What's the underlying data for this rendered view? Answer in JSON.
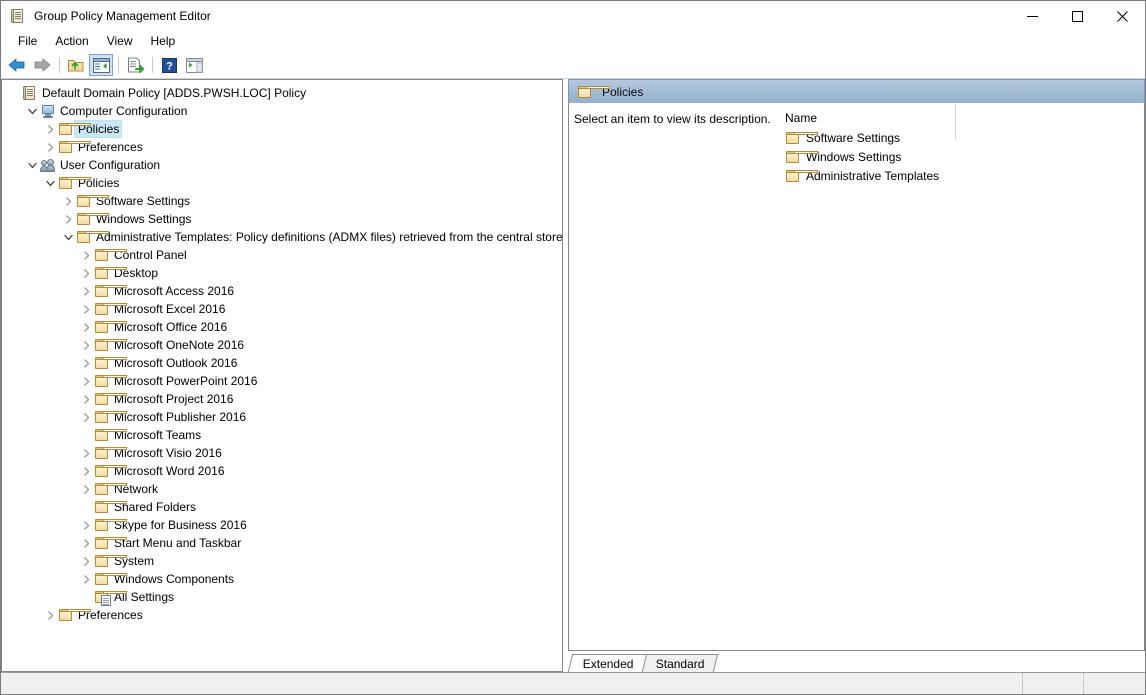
{
  "window": {
    "title": "Group Policy Management Editor",
    "icon": "gpo-document-icon",
    "minimize_label": "Minimize",
    "maximize_label": "Maximize",
    "close_label": "Close"
  },
  "menubar": {
    "items": [
      {
        "label": "File"
      },
      {
        "label": "Action"
      },
      {
        "label": "View"
      },
      {
        "label": "Help"
      }
    ]
  },
  "toolbar": {
    "buttons": [
      {
        "name": "back-button",
        "icon": "back-arrow-icon",
        "pressed": false
      },
      {
        "name": "forward-button",
        "icon": "forward-arrow-icon",
        "pressed": false
      },
      {
        "name": "up-one-level-button",
        "icon": "folder-up-icon",
        "pressed": false
      },
      {
        "name": "show-hide-console-tree-button",
        "icon": "console-tree-icon",
        "pressed": true
      },
      {
        "name": "export-list-button",
        "icon": "export-list-icon",
        "pressed": false
      },
      {
        "name": "help-button",
        "icon": "help-question-icon",
        "pressed": false
      },
      {
        "name": "show-hide-action-pane-button",
        "icon": "action-pane-icon",
        "pressed": false
      }
    ]
  },
  "tree": {
    "nodes": [
      {
        "label": "Default Domain Policy [ADDS.PWSH.LOC] Policy",
        "indent": 0,
        "chevron": "none",
        "icon": "gpo-document-icon",
        "selected": false
      },
      {
        "label": "Computer Configuration",
        "indent": 1,
        "chevron": "expanded",
        "icon": "computer-icon",
        "selected": false
      },
      {
        "label": "Policies",
        "indent": 2,
        "chevron": "collapsed",
        "icon": "folder-icon",
        "selected": true
      },
      {
        "label": "Preferences",
        "indent": 2,
        "chevron": "collapsed",
        "icon": "folder-icon",
        "selected": false
      },
      {
        "label": "User Configuration",
        "indent": 1,
        "chevron": "expanded",
        "icon": "users-icon",
        "selected": false
      },
      {
        "label": "Policies",
        "indent": 2,
        "chevron": "expanded",
        "icon": "folder-icon",
        "selected": false
      },
      {
        "label": "Software Settings",
        "indent": 3,
        "chevron": "collapsed",
        "icon": "folder-icon",
        "selected": false
      },
      {
        "label": "Windows Settings",
        "indent": 3,
        "chevron": "collapsed",
        "icon": "folder-icon",
        "selected": false
      },
      {
        "label": "Administrative Templates: Policy definitions (ADMX files) retrieved from the central store.",
        "indent": 3,
        "chevron": "expanded",
        "icon": "folder-icon",
        "selected": false
      },
      {
        "label": "Control Panel",
        "indent": 4,
        "chevron": "collapsed",
        "icon": "folder-icon",
        "selected": false
      },
      {
        "label": "Desktop",
        "indent": 4,
        "chevron": "collapsed",
        "icon": "folder-icon",
        "selected": false
      },
      {
        "label": "Microsoft Access 2016",
        "indent": 4,
        "chevron": "collapsed",
        "icon": "folder-icon",
        "selected": false
      },
      {
        "label": "Microsoft Excel 2016",
        "indent": 4,
        "chevron": "collapsed",
        "icon": "folder-icon",
        "selected": false
      },
      {
        "label": "Microsoft Office 2016",
        "indent": 4,
        "chevron": "collapsed",
        "icon": "folder-icon",
        "selected": false
      },
      {
        "label": "Microsoft OneNote 2016",
        "indent": 4,
        "chevron": "collapsed",
        "icon": "folder-icon",
        "selected": false
      },
      {
        "label": "Microsoft Outlook 2016",
        "indent": 4,
        "chevron": "collapsed",
        "icon": "folder-icon",
        "selected": false
      },
      {
        "label": "Microsoft PowerPoint 2016",
        "indent": 4,
        "chevron": "collapsed",
        "icon": "folder-icon",
        "selected": false
      },
      {
        "label": "Microsoft Project 2016",
        "indent": 4,
        "chevron": "collapsed",
        "icon": "folder-icon",
        "selected": false
      },
      {
        "label": "Microsoft Publisher 2016",
        "indent": 4,
        "chevron": "collapsed",
        "icon": "folder-icon",
        "selected": false
      },
      {
        "label": "Microsoft Teams",
        "indent": 4,
        "chevron": "none",
        "icon": "folder-icon",
        "selected": false
      },
      {
        "label": "Microsoft Visio 2016",
        "indent": 4,
        "chevron": "collapsed",
        "icon": "folder-icon",
        "selected": false
      },
      {
        "label": "Microsoft Word 2016",
        "indent": 4,
        "chevron": "collapsed",
        "icon": "folder-icon",
        "selected": false
      },
      {
        "label": "Network",
        "indent": 4,
        "chevron": "collapsed",
        "icon": "folder-icon",
        "selected": false
      },
      {
        "label": "Shared Folders",
        "indent": 4,
        "chevron": "none",
        "icon": "folder-icon",
        "selected": false
      },
      {
        "label": "Skype for Business 2016",
        "indent": 4,
        "chevron": "collapsed",
        "icon": "folder-icon",
        "selected": false
      },
      {
        "label": "Start Menu and Taskbar",
        "indent": 4,
        "chevron": "collapsed",
        "icon": "folder-icon",
        "selected": false
      },
      {
        "label": "System",
        "indent": 4,
        "chevron": "collapsed",
        "icon": "folder-icon",
        "selected": false
      },
      {
        "label": "Windows Components",
        "indent": 4,
        "chevron": "collapsed",
        "icon": "folder-icon",
        "selected": false
      },
      {
        "label": "All Settings",
        "indent": 4,
        "chevron": "none",
        "icon": "all-settings-icon",
        "selected": false
      },
      {
        "label": "Preferences",
        "indent": 2,
        "chevron": "collapsed",
        "icon": "folder-icon",
        "selected": false
      }
    ]
  },
  "right_pane": {
    "header": {
      "title": "Policies",
      "icon": "folder-icon"
    },
    "description": "Select an item to view its description.",
    "columns": [
      "Name"
    ],
    "items": [
      {
        "label": "Software Settings",
        "icon": "folder-icon"
      },
      {
        "label": "Windows Settings",
        "icon": "folder-icon"
      },
      {
        "label": "Administrative Templates",
        "icon": "folder-icon"
      }
    ],
    "tabs": [
      {
        "label": "Extended",
        "active": true
      },
      {
        "label": "Standard",
        "active": false
      }
    ]
  },
  "statusbar": {
    "text": "",
    "segment_1": "",
    "segment_2": ""
  },
  "colors": {
    "header_gradient_top": "#b4c9de",
    "header_gradient_bottom": "#93b0cd",
    "selection": "#cbe8f6",
    "folder_face": "#f3dba2",
    "folder_edge": "#b08c3c",
    "pane_border": "#828790",
    "statusbar_bg": "#f0f0f0"
  }
}
